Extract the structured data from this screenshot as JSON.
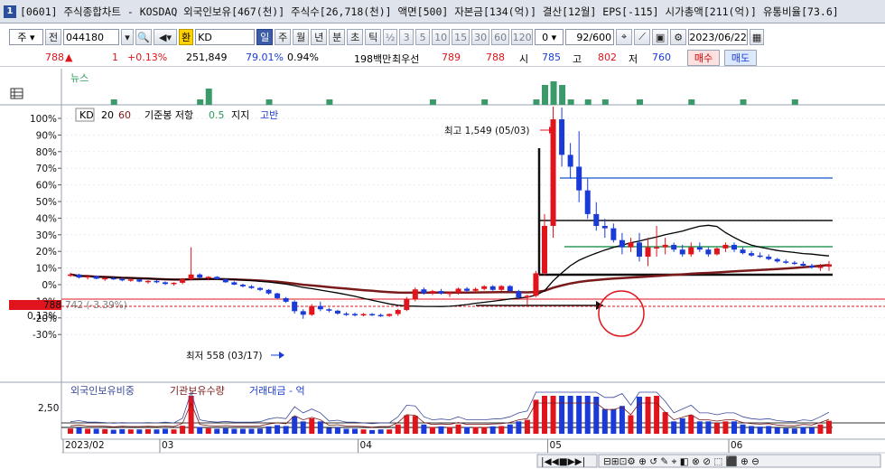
{
  "window": {
    "icon_label": "1",
    "title": "[0601] 주식종합차트 - KOSDAQ 외국인보유[467(천)] 주식수[26,718(천)] 액면[500] 자본금[134(억)] 결산[12월] EPS[-115] 시가총액[211(억)] 유통비율[73.6]"
  },
  "toolbar": {
    "period_select": "주",
    "code_label": "전",
    "code_value": "044180",
    "indicator_toggle": "환",
    "indicator_value": "KD",
    "period_tabs": [
      "일",
      "주",
      "월",
      "년",
      "분",
      "초",
      "틱"
    ],
    "active_period": "일",
    "intervals": [
      "½",
      "3",
      "5",
      "10",
      "15",
      "30",
      "60",
      "120"
    ],
    "offset_value": "0",
    "bar_count": "92/600",
    "date_value": "2023/06/22"
  },
  "quote": {
    "price": "788",
    "change_arrow": "▲",
    "change": "1",
    "change_pct": "+0.13%",
    "volume": "251,849",
    "ratio1": "79.01%",
    "ratio2": "0.94%",
    "amount": "198백만",
    "best_quote_label": "최우선",
    "best_ask": "789",
    "best_bid": "788",
    "open_label": "시",
    "open": "785",
    "high_label": "고",
    "high": "802",
    "low_label": "저",
    "low": "760",
    "buy_button": "매수",
    "sell_button": "매도"
  },
  "news_panel": {
    "title": "뉴스"
  },
  "legend": {
    "kd_label": "KD",
    "kd_p1": "20",
    "kd_p2": "60",
    "candle_label": "기준봉 저항",
    "candle_value": "0.5",
    "support_label": "지지",
    "gap_label": "고반"
  },
  "annotations": {
    "high_label": "최고 1,549 (05/03)",
    "low_label": "최저 558 (03/17)",
    "current_price_tag": "788",
    "current_pct_tag": "0.13%",
    "ref_label": "742 (-3.39%)"
  },
  "lower_legend": {
    "s1": "외국인보유비중",
    "s2": "기관보유수량",
    "s3": "거래대금 - 억",
    "ylabel": "2,50"
  },
  "chart_data": {
    "type": "candlestick",
    "y_ticks": [
      "100%",
      "90%",
      "80%",
      "70%",
      "60%",
      "50%",
      "40%",
      "30%",
      "20%",
      "10%",
      "0%",
      "-10%",
      "-20%",
      "-30%"
    ],
    "x_labels": [
      "2023/02",
      "03",
      "04",
      "05",
      "06"
    ],
    "colors": {
      "up": "#e0141c",
      "down": "#1a3bd8",
      "ma_short": "#000000",
      "ma_long": "#7a1a1a",
      "resist_blue": "#3c6fd8",
      "resist_green": "#2f9a5a"
    },
    "candles": [
      [
        0,
        742,
        752,
        735,
        745
      ],
      [
        0,
        745,
        748,
        728,
        732
      ],
      [
        0,
        732,
        740,
        724,
        738
      ],
      [
        0,
        738,
        741,
        725,
        727
      ],
      [
        0,
        727,
        733,
        718,
        730
      ],
      [
        0,
        730,
        735,
        722,
        726
      ],
      [
        0,
        726,
        731,
        716,
        720
      ],
      [
        0,
        720,
        728,
        714,
        724
      ],
      [
        0,
        724,
        726,
        712,
        715
      ],
      [
        0,
        715,
        721,
        706,
        718
      ],
      [
        0,
        718,
        722,
        708,
        712
      ],
      [
        0,
        712,
        716,
        700,
        705
      ],
      [
        0,
        705,
        712,
        698,
        710
      ],
      [
        0,
        710,
        730,
        704,
        725
      ],
      [
        0,
        725,
        860,
        720,
        745
      ],
      [
        0,
        745,
        750,
        728,
        732
      ],
      [
        0,
        732,
        738,
        720,
        735
      ],
      [
        0,
        735,
        738,
        722,
        725
      ],
      [
        0,
        725,
        728,
        710,
        712
      ],
      [
        0,
        712,
        716,
        700,
        702
      ],
      [
        0,
        702,
        706,
        690,
        695
      ],
      [
        0,
        695,
        700,
        684,
        688
      ],
      [
        0,
        688,
        692,
        675,
        680
      ],
      [
        0,
        680,
        684,
        660,
        665
      ],
      [
        0,
        665,
        668,
        640,
        645
      ],
      [
        0,
        645,
        650,
        625,
        630
      ],
      [
        0,
        630,
        636,
        580,
        590
      ],
      [
        0,
        590,
        598,
        558,
        575
      ],
      [
        0,
        575,
        620,
        570,
        612
      ],
      [
        0,
        612,
        630,
        590,
        598
      ],
      [
        0,
        598,
        604,
        585,
        592
      ],
      [
        0,
        592,
        596,
        575,
        580
      ],
      [
        0,
        580,
        586,
        570,
        578
      ],
      [
        0,
        578,
        584,
        568,
        575
      ],
      [
        0,
        575,
        582,
        568,
        578
      ],
      [
        0,
        578,
        582,
        570,
        574
      ],
      [
        0,
        574,
        580,
        566,
        570
      ],
      [
        0,
        570,
        580,
        566,
        578
      ],
      [
        0,
        578,
        600,
        570,
        595
      ],
      [
        0,
        595,
        650,
        590,
        640
      ],
      [
        0,
        640,
        690,
        632,
        682
      ],
      [
        0,
        682,
        690,
        660,
        666
      ],
      [
        0,
        666,
        680,
        658,
        675
      ],
      [
        0,
        675,
        684,
        660,
        664
      ],
      [
        0,
        664,
        672,
        650,
        668
      ],
      [
        0,
        668,
        690,
        660,
        685
      ],
      [
        0,
        685,
        692,
        670,
        676
      ],
      [
        0,
        676,
        690,
        668,
        684
      ],
      [
        0,
        684,
        700,
        678,
        695
      ],
      [
        0,
        695,
        700,
        676,
        680
      ],
      [
        0,
        680,
        700,
        675,
        696
      ],
      [
        0,
        696,
        700,
        670,
        675
      ],
      [
        0,
        675,
        680,
        640,
        648
      ],
      [
        0,
        648,
        660,
        615,
        655
      ],
      [
        0,
        655,
        760,
        650,
        750
      ],
      [
        0,
        750,
        1000,
        740,
        950
      ],
      [
        0,
        950,
        1549,
        900,
        1400
      ],
      [
        0,
        1400,
        1450,
        1200,
        1250
      ],
      [
        0,
        1250,
        1300,
        1150,
        1200
      ],
      [
        0,
        1200,
        1350,
        1050,
        1100
      ],
      [
        0,
        1100,
        1150,
        980,
        1000
      ],
      [
        0,
        1000,
        1050,
        930,
        950
      ],
      [
        0,
        950,
        980,
        900,
        940
      ],
      [
        0,
        940,
        960,
        880,
        890
      ],
      [
        0,
        890,
        920,
        830,
        860
      ],
      [
        0,
        860,
        900,
        840,
        880
      ],
      [
        0,
        880,
        920,
        800,
        820
      ],
      [
        0,
        820,
        900,
        780,
        860
      ],
      [
        0,
        860,
        950,
        820,
        860
      ],
      [
        0,
        860,
        900,
        830,
        870
      ],
      [
        0,
        870,
        880,
        840,
        850
      ],
      [
        0,
        850,
        870,
        820,
        830
      ],
      [
        0,
        830,
        880,
        820,
        860
      ],
      [
        0,
        860,
        880,
        840,
        850
      ],
      [
        0,
        850,
        860,
        820,
        830
      ],
      [
        0,
        830,
        860,
        825,
        855
      ],
      [
        0,
        855,
        880,
        840,
        870
      ],
      [
        0,
        870,
        880,
        840,
        850
      ],
      [
        0,
        850,
        860,
        830,
        835
      ],
      [
        0,
        835,
        845,
        820,
        825
      ],
      [
        0,
        825,
        838,
        815,
        820
      ],
      [
        0,
        820,
        830,
        805,
        810
      ],
      [
        0,
        810,
        815,
        795,
        800
      ],
      [
        0,
        800,
        808,
        790,
        795
      ],
      [
        0,
        795,
        802,
        785,
        790
      ],
      [
        0,
        790,
        800,
        778,
        782
      ],
      [
        0,
        782,
        790,
        770,
        775
      ],
      [
        0,
        775,
        790,
        760,
        778
      ],
      [
        0,
        778,
        802,
        760,
        788
      ]
    ]
  }
}
